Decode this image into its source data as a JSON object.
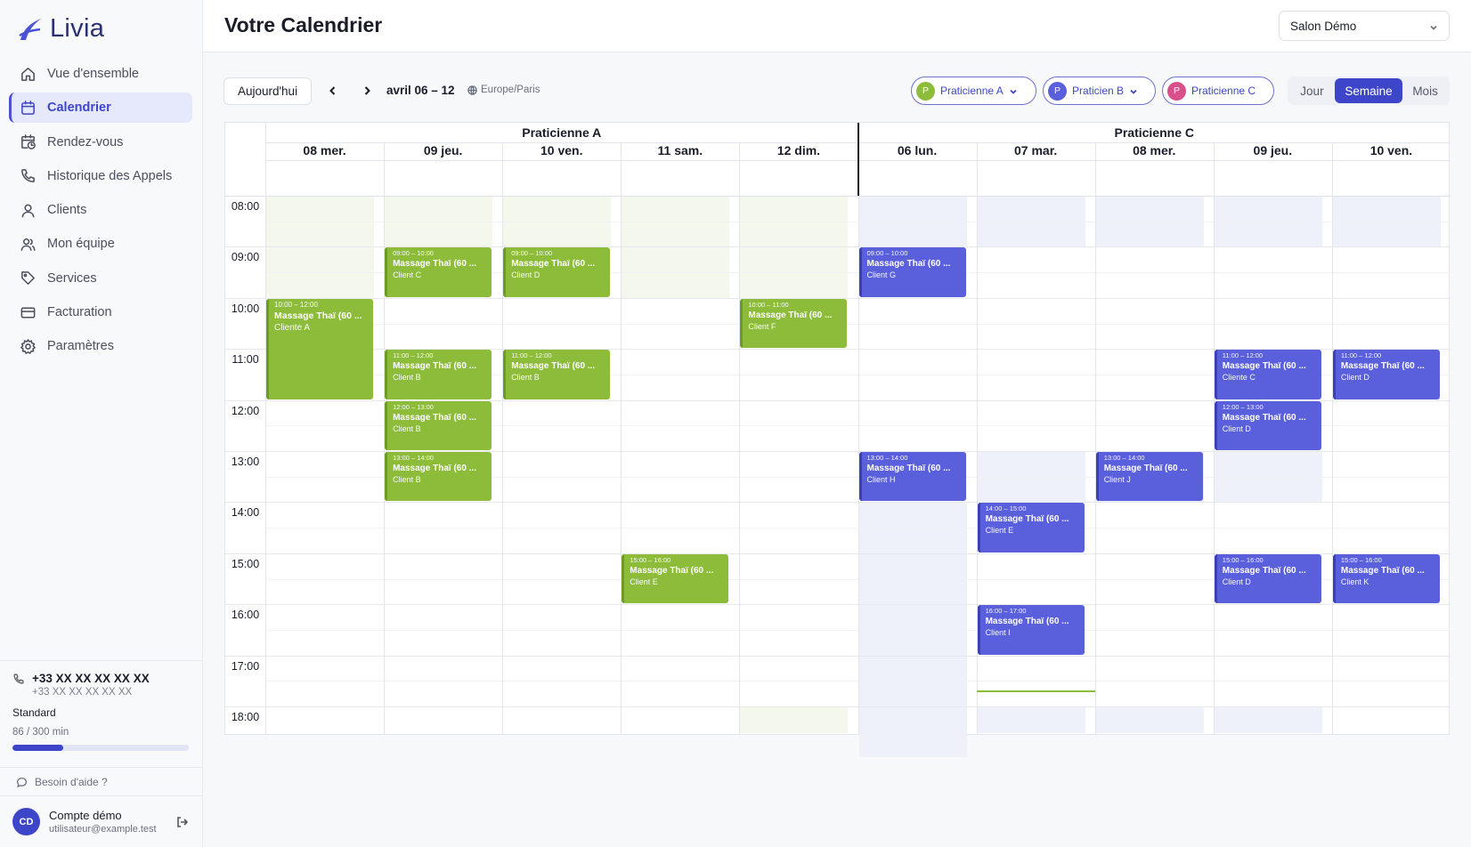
{
  "app": {
    "logo": "Livia"
  },
  "sidebar": {
    "items": [
      {
        "label": "Vue d'ensemble",
        "icon": "home-icon",
        "active": false
      },
      {
        "label": "Calendrier",
        "icon": "calendar-icon",
        "active": true
      },
      {
        "label": "Rendez-vous",
        "icon": "calendar-clock-icon",
        "active": false
      },
      {
        "label": "Historique des Appels",
        "icon": "phone-icon",
        "active": false
      },
      {
        "label": "Clients",
        "icon": "user-icon",
        "active": false
      },
      {
        "label": "Mon équipe",
        "icon": "users-icon",
        "active": false
      },
      {
        "label": "Services",
        "icon": "tag-icon",
        "active": false
      },
      {
        "label": "Facturation",
        "icon": "credit-card-icon",
        "active": false
      },
      {
        "label": "Paramètres",
        "icon": "gear-icon",
        "active": false
      }
    ],
    "phone": {
      "number": "+33 XX XX XX XX XX",
      "sub": "+33 XX XX XX XX XX"
    },
    "plan": "Standard",
    "usage": {
      "text": "86 / 300 min",
      "fraction": 0.2867
    },
    "help": "Besoin d'aide ?",
    "account": {
      "initials": "CD",
      "name": "Compte démo",
      "email": "utilisateur@example.test"
    }
  },
  "header": {
    "title": "Votre Calendrier",
    "salon": "Salon Démo"
  },
  "toolbar": {
    "today": "Aujourd'hui",
    "range": "avril 06 – 12",
    "timezone": "Europe/Paris",
    "practitioners": [
      {
        "initial": "P",
        "name": "Praticienne A",
        "color": "#8cbc3a"
      },
      {
        "initial": "P",
        "name": "Praticien B",
        "color": "#5a5fdc"
      },
      {
        "initial": "P",
        "name": "Praticienne C",
        "color": "#d94f8a"
      }
    ],
    "views": [
      {
        "label": "Jour",
        "active": false
      },
      {
        "label": "Semaine",
        "active": true
      },
      {
        "label": "Mois",
        "active": false
      }
    ]
  },
  "calendar": {
    "groups": [
      {
        "name": "Praticienne A",
        "start": 0,
        "count": 5
      },
      {
        "name": "Praticienne C",
        "start": 5,
        "count": 5
      }
    ],
    "days": [
      "08 mer.",
      "09 jeu.",
      "10 ven.",
      "11 sam.",
      "12 dim.",
      "06 lun.",
      "07 mar.",
      "08 mer.",
      "09 jeu.",
      "10 ven."
    ],
    "times": [
      "08:00",
      "09:00",
      "10:00",
      "11:00",
      "12:00",
      "13:00",
      "14:00",
      "15:00",
      "16:00",
      "17:00",
      "18:00"
    ],
    "events": [
      {
        "col": 0,
        "start": 10,
        "end": 12,
        "time": "10:00 – 12:00",
        "title": "Massage Thaï (60 ...",
        "client": "Cliente A",
        "color": "g"
      },
      {
        "col": 1,
        "start": 9,
        "end": 10,
        "time": "09:00 – 10:00",
        "title": "Massage Thaï (60 ...",
        "client": "Client C",
        "color": "g"
      },
      {
        "col": 1,
        "start": 11,
        "end": 12,
        "time": "11:00 – 12:00",
        "title": "Massage Thaï (60 ...",
        "client": "Client B",
        "color": "g"
      },
      {
        "col": 1,
        "start": 12,
        "end": 13,
        "time": "12:00 – 13:00",
        "title": "Massage Thaï (60 ...",
        "client": "Client B",
        "color": "g"
      },
      {
        "col": 1,
        "start": 13,
        "end": 14,
        "time": "13:00 – 14:00",
        "title": "Massage Thaï (60 ...",
        "client": "Client B",
        "color": "g"
      },
      {
        "col": 2,
        "start": 9,
        "end": 10,
        "time": "09:00 – 10:00",
        "title": "Massage Thaï (60 ...",
        "client": "Client D",
        "color": "g"
      },
      {
        "col": 2,
        "start": 11,
        "end": 12,
        "time": "11:00 – 12:00",
        "title": "Massage Thaï (60 ...",
        "client": "Client B",
        "color": "g"
      },
      {
        "col": 3,
        "start": 15,
        "end": 16,
        "time": "15:00 – 16:00",
        "title": "Massage Thaï (60 ...",
        "client": "Client E",
        "color": "g"
      },
      {
        "col": 4,
        "start": 10,
        "end": 11,
        "time": "10:00 – 11:00",
        "title": "Massage Thaï (60 ...",
        "client": "Client F",
        "color": "g"
      },
      {
        "col": 5,
        "start": 9,
        "end": 10,
        "time": "09:00 – 10:00",
        "title": "Massage Thaï (60 ...",
        "client": "Client G",
        "color": "b"
      },
      {
        "col": 5,
        "start": 13,
        "end": 14,
        "time": "13:00 – 14:00",
        "title": "Massage Thaï (60 ...",
        "client": "Client H",
        "color": "b"
      },
      {
        "col": 6,
        "start": 14,
        "end": 15,
        "time": "14:00 – 15:00",
        "title": "Massage Thaï (60 ...",
        "client": "Client E",
        "color": "b"
      },
      {
        "col": 6,
        "start": 16,
        "end": 17,
        "time": "16:00 – 17:00",
        "title": "Massage Thaï (60 ...",
        "client": "Client I",
        "color": "b"
      },
      {
        "col": 7,
        "start": 13,
        "end": 14,
        "time": "13:00 – 14:00",
        "title": "Massage Thaï (60 ...",
        "client": "Client J",
        "color": "b"
      },
      {
        "col": 8,
        "start": 11,
        "end": 12,
        "time": "11:00 – 12:00",
        "title": "Massage Thaï (60 ...",
        "client": "Cliente C",
        "color": "b"
      },
      {
        "col": 8,
        "start": 12,
        "end": 13,
        "time": "12:00 – 13:00",
        "title": "Massage Thaï (60 ...",
        "client": "Client D",
        "color": "b"
      },
      {
        "col": 8,
        "start": 15,
        "end": 16,
        "time": "15:00 – 16:00",
        "title": "Massage Thaï (60 ...",
        "client": "Client D",
        "color": "b"
      },
      {
        "col": 9,
        "start": 11,
        "end": 12,
        "time": "11:00 – 12:00",
        "title": "Massage Thaï (60 ...",
        "client": "Client D",
        "color": "b"
      },
      {
        "col": 9,
        "start": 15,
        "end": 16,
        "time": "15:00 – 16:00",
        "title": "Massage Thaï (60 ...",
        "client": "Client K",
        "color": "b"
      }
    ]
  }
}
